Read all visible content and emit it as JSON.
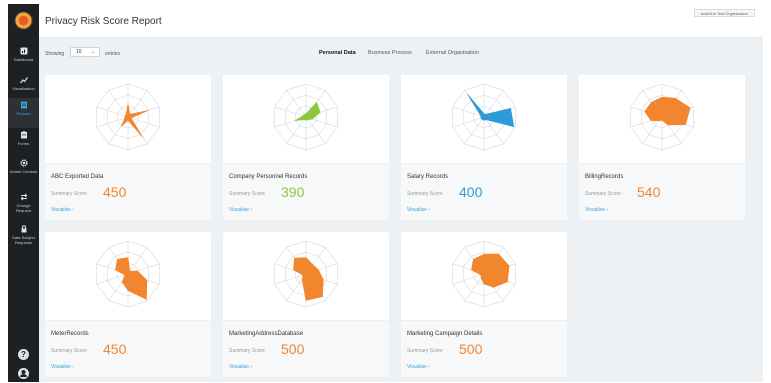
{
  "header": {
    "title": "Privacy Risk Score Report",
    "organisation": "trustHub Test Organisation"
  },
  "sidebar": {
    "items": [
      {
        "label": "Dashboard",
        "icon": "dashboard-icon"
      },
      {
        "label": "Visualisation",
        "icon": "trend-icon"
      },
      {
        "label": "Reports",
        "icon": "report-icon",
        "active": true
      },
      {
        "label": "Forms",
        "icon": "clipboard-icon"
      },
      {
        "label": "Admin Controls",
        "icon": "gear-icon"
      },
      {
        "label": "Change Request",
        "icon": "exchange-icon"
      },
      {
        "label": "Data Subject Requests",
        "icon": "lock-icon"
      }
    ],
    "help_icon": "help-icon",
    "user_icon": "user-icon"
  },
  "controls": {
    "showing_label": "Showing",
    "entries_value": "10",
    "entries_label": "entries",
    "tabs": [
      {
        "label": "Personal Data",
        "active": true
      },
      {
        "label": "Business Process",
        "active": false
      },
      {
        "label": "External Organisation",
        "active": false
      }
    ]
  },
  "cards": [
    {
      "title": "ABC Exported Data",
      "score_label": "Summary Score",
      "score": "450",
      "color": "#f2862f",
      "link": "Visualise",
      "radar": [
        0.4,
        0.1,
        0.65,
        0.1,
        0.75,
        0.1,
        0.35,
        0.1,
        0.1,
        0.1
      ]
    },
    {
      "title": "Company Personnel Records",
      "score_label": "Summary Score",
      "score": "390",
      "color": "#8dc63f",
      "link": "Visualise",
      "radar": [
        0.1,
        0.55,
        0.45,
        0.2,
        0.1,
        0.1,
        0.1,
        0.35,
        0.1,
        0.1
      ]
    },
    {
      "title": "Salary Records",
      "score_label": "Summary Score",
      "score": "400",
      "color": "#2e9ad8",
      "link": "Visualise",
      "radar": [
        0.1,
        0.1,
        0.85,
        0.95,
        0.1,
        0.1,
        0.1,
        0.1,
        0.1,
        0.85
      ]
    },
    {
      "title": "BillingRecords",
      "score_label": "Summary Score",
      "score": "540",
      "color": "#f2862f",
      "link": "Visualise",
      "radar": [
        0.6,
        0.7,
        0.9,
        0.75,
        0.3,
        0.1,
        0.15,
        0.35,
        0.55,
        0.55
      ]
    },
    {
      "title": "MeterRecords",
      "score_label": "Summary Score",
      "score": "450",
      "color": "#f2862f",
      "link": "Visualise",
      "radar": [
        0.5,
        0.1,
        0.3,
        0.6,
        0.95,
        0.5,
        0.3,
        0.1,
        0.4,
        0.55
      ]
    },
    {
      "title": "MarketingAddressDatabase",
      "score_label": "Summary Score",
      "score": "500",
      "color": "#f2862f",
      "link": "Visualise",
      "radar": [
        0.5,
        0.35,
        0.4,
        0.55,
        0.85,
        0.8,
        0.2,
        0.1,
        0.4,
        0.6
      ]
    },
    {
      "title": "Marketing Campaign Details",
      "score_label": "Summary Score",
      "score": "500",
      "color": "#f2862f",
      "link": "Visualise",
      "radar": [
        0.6,
        0.75,
        0.8,
        0.75,
        0.5,
        0.3,
        0.15,
        0.1,
        0.4,
        0.55
      ]
    }
  ]
}
